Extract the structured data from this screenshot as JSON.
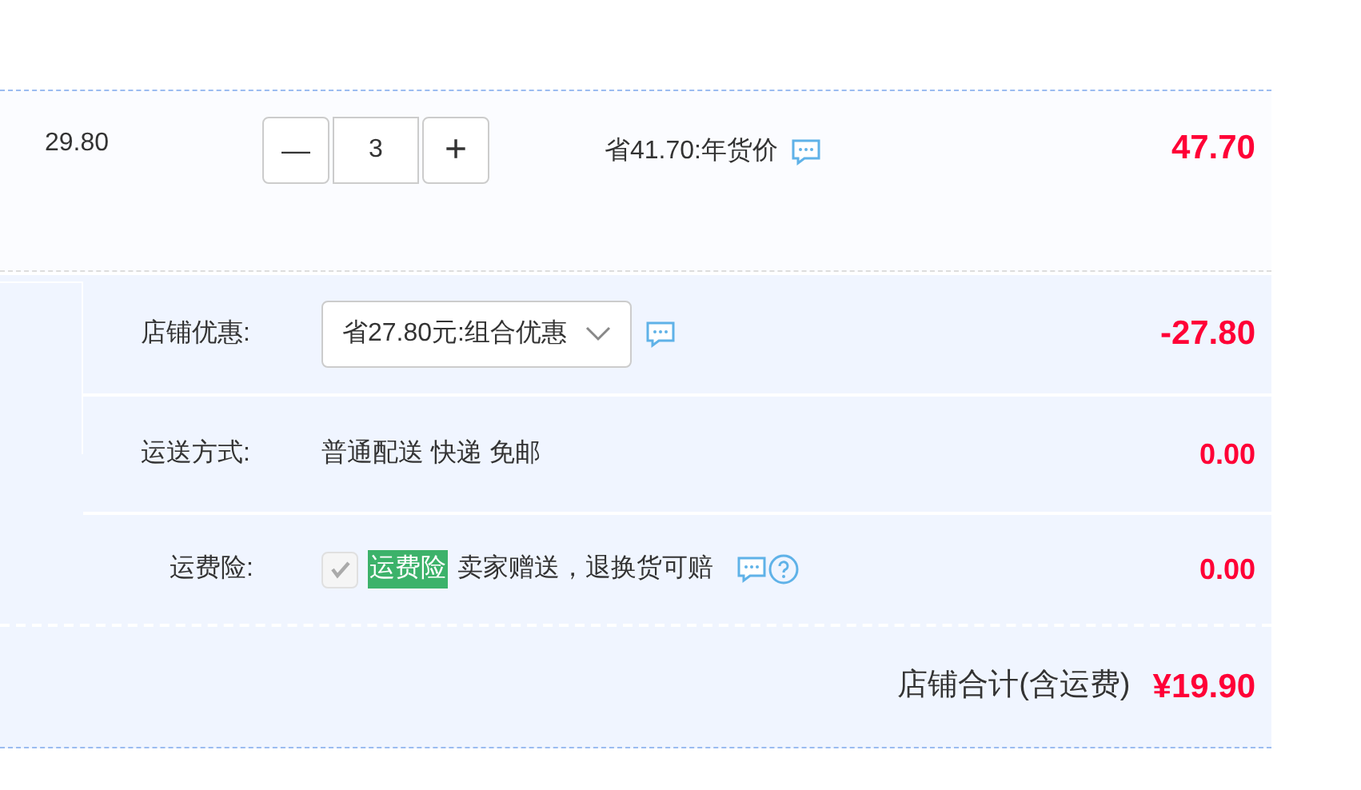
{
  "item": {
    "unit_price": "29.80",
    "quantity": "3",
    "minus": "—",
    "plus": "+",
    "promo": "省41.70:年货价",
    "subtotal": "47.70"
  },
  "store_discount": {
    "label": "店铺优惠:",
    "selection": "省27.80元:组合优惠",
    "amount": "-27.80"
  },
  "shipping": {
    "label": "运送方式:",
    "method": "普通配送 快递 免邮",
    "amount": "0.00"
  },
  "insurance": {
    "label": "运费险:",
    "checked": true,
    "disabled": true,
    "badge": "运费险",
    "description": "卖家赠送，退换货可赔",
    "amount": "0.00"
  },
  "total": {
    "label": "店铺合计(含运费)",
    "amount": "¥19.90"
  }
}
